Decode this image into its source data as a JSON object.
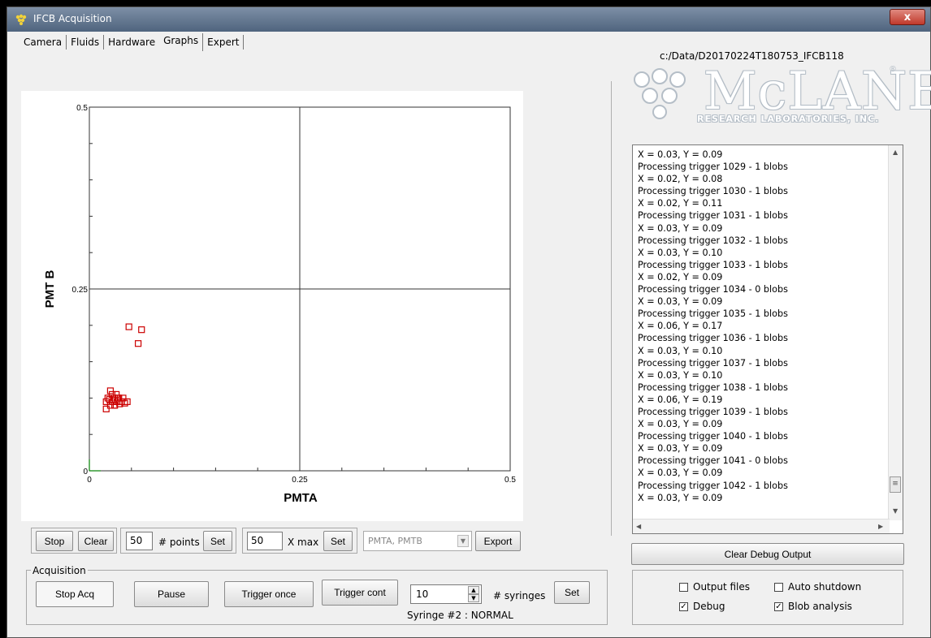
{
  "window": {
    "title": "IFCB Acquisition",
    "close_label": "x"
  },
  "tabs": [
    {
      "label": "Camera"
    },
    {
      "label": "Fluids"
    },
    {
      "label": "Hardware"
    },
    {
      "label": "Graphs"
    },
    {
      "label": "Expert"
    }
  ],
  "active_tab": "Graphs",
  "data_path": "c:/Data/D20170224T180753_IFCB118",
  "logo": {
    "wordmark": "McLANE",
    "subtitle": "RESEARCH LABORATORIES, INC.",
    "registered": "®"
  },
  "chart_data": {
    "type": "scatter",
    "xlabel": "PMTA",
    "ylabel": "PMT B",
    "xlim": [
      0,
      0.5
    ],
    "ylim": [
      0,
      0.5
    ],
    "x_ticks": [
      "0",
      "0.25",
      "0.5"
    ],
    "y_ticks": [
      "0",
      "0.25",
      "0.5"
    ],
    "marker_color": "#cc0000",
    "marker": "square",
    "grid": "center crosshair",
    "points": [
      {
        "x": 0.02,
        "y": 0.085
      },
      {
        "x": 0.025,
        "y": 0.09
      },
      {
        "x": 0.02,
        "y": 0.095
      },
      {
        "x": 0.022,
        "y": 0.1
      },
      {
        "x": 0.025,
        "y": 0.11
      },
      {
        "x": 0.028,
        "y": 0.095
      },
      {
        "x": 0.03,
        "y": 0.1
      },
      {
        "x": 0.03,
        "y": 0.09
      },
      {
        "x": 0.033,
        "y": 0.095
      },
      {
        "x": 0.035,
        "y": 0.1
      },
      {
        "x": 0.032,
        "y": 0.105
      },
      {
        "x": 0.027,
        "y": 0.105
      },
      {
        "x": 0.038,
        "y": 0.095
      },
      {
        "x": 0.04,
        "y": 0.1
      },
      {
        "x": 0.03,
        "y": 0.09
      },
      {
        "x": 0.036,
        "y": 0.092
      },
      {
        "x": 0.042,
        "y": 0.093
      },
      {
        "x": 0.045,
        "y": 0.095
      },
      {
        "x": 0.024,
        "y": 0.098
      },
      {
        "x": 0.034,
        "y": 0.1
      },
      {
        "x": 0.047,
        "y": 0.198
      },
      {
        "x": 0.062,
        "y": 0.194
      },
      {
        "x": 0.058,
        "y": 0.175
      }
    ]
  },
  "plot_controls": {
    "stop_label": "Stop",
    "clear_label": "Clear",
    "points_value": "50",
    "points_label": "# points",
    "set_points_label": "Set",
    "xmax_value": "50",
    "xmax_label": "X max",
    "set_xmax_label": "Set",
    "series_select": "PMTA, PMTB",
    "export_label": "Export"
  },
  "debug_output": {
    "lines": [
      "X = 0.03, Y = 0.09",
      "Processing trigger 1029 - 1 blobs",
      "X = 0.02, Y = 0.08",
      "Processing trigger 1030 - 1 blobs",
      "X = 0.02, Y = 0.11",
      "Processing trigger 1031 - 1 blobs",
      "X = 0.03, Y = 0.09",
      "Processing trigger 1032 - 1 blobs",
      "X = 0.03, Y = 0.10",
      "Processing trigger 1033 - 1 blobs",
      "X = 0.02, Y = 0.09",
      "Processing trigger 1034 - 0 blobs",
      "X = 0.03, Y = 0.09",
      "Processing trigger 1035 - 1 blobs",
      "X = 0.06, Y = 0.17",
      "Processing trigger 1036 - 1 blobs",
      "X = 0.03, Y = 0.10",
      "Processing trigger 1037 - 1 blobs",
      "X = 0.03, Y = 0.10",
      "Processing trigger 1038 - 1 blobs",
      "X = 0.06, Y = 0.19",
      "Processing trigger 1039 - 1 blobs",
      "X = 0.03, Y = 0.09",
      "Processing trigger 1040 - 1 blobs",
      "X = 0.03, Y = 0.09",
      "Processing trigger 1041 - 0 blobs",
      "X = 0.03, Y = 0.09",
      "Processing trigger 1042 - 1 blobs",
      "X = 0.03, Y = 0.09"
    ],
    "clear_label": "Clear Debug Output"
  },
  "acquisition": {
    "group_label": "Acquisition",
    "stop_acq_label": "Stop Acq",
    "pause_label": "Pause",
    "trigger_once_label": "Trigger once",
    "trigger_cont_label": "Trigger cont",
    "syringes_value": "10",
    "syringes_label": "# syringes",
    "set_label": "Set",
    "status": "Syringe #2 : NORMAL"
  },
  "options": {
    "output_files": {
      "label": "Output files",
      "checked": false
    },
    "auto_shutdown": {
      "label": "Auto shutdown",
      "checked": false
    },
    "debug": {
      "label": "Debug",
      "checked": true
    },
    "blob_analysis": {
      "label": "Blob analysis",
      "checked": true
    }
  },
  "colors": {
    "titlebar": "#5a6f8a",
    "marker": "#cc0000",
    "axis": "#008000"
  }
}
